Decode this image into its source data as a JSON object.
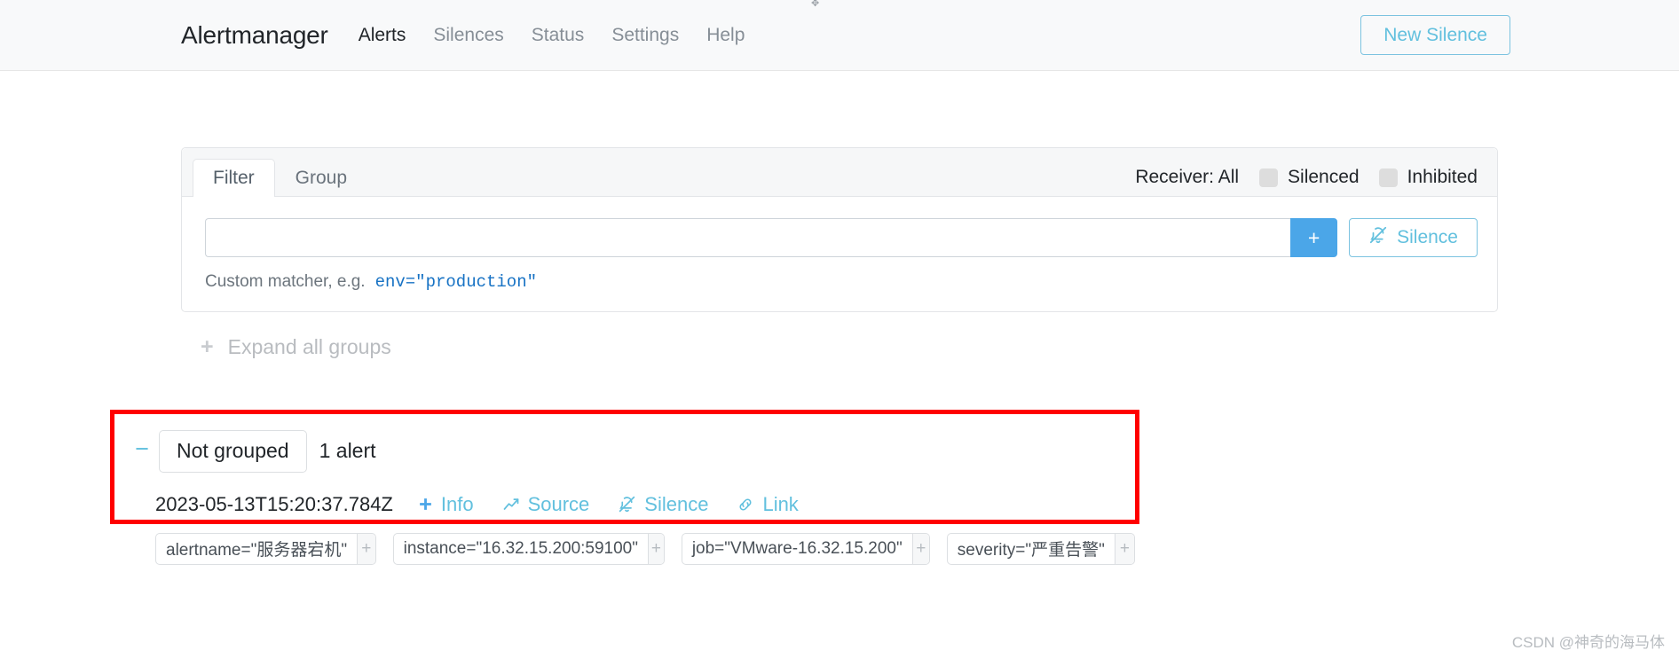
{
  "navbar": {
    "brand": "Alertmanager",
    "links": [
      {
        "label": "Alerts",
        "active": true
      },
      {
        "label": "Silences",
        "active": false
      },
      {
        "label": "Status",
        "active": false
      },
      {
        "label": "Settings",
        "active": false
      },
      {
        "label": "Help",
        "active": false
      }
    ],
    "new_silence_label": "New Silence"
  },
  "filter_card": {
    "tabs": [
      {
        "label": "Filter",
        "active": true
      },
      {
        "label": "Group",
        "active": false
      }
    ],
    "receiver_label": "Receiver: All",
    "checkboxes": [
      {
        "label": "Silenced",
        "checked": false
      },
      {
        "label": "Inhibited",
        "checked": false
      }
    ],
    "matcher_input_value": "",
    "matcher_input_placeholder": "",
    "add_button_label": "+",
    "silence_button_label": "Silence",
    "matcher_help_prefix": "Custom matcher, e.g.",
    "matcher_help_code": "env=\"production\""
  },
  "expand_all": {
    "icon_label": "+",
    "label": "Expand all groups"
  },
  "group": {
    "collapse_icon_label": "−",
    "name": "Not grouped",
    "alert_count": "1 alert",
    "alerts": [
      {
        "timestamp": "2023-05-13T15:20:37.784Z",
        "actions": [
          {
            "label": "Info",
            "icon": "plus-icon"
          },
          {
            "label": "Source",
            "icon": "chart-line-icon"
          },
          {
            "label": "Silence",
            "icon": "bell-slash-icon"
          },
          {
            "label": "Link",
            "icon": "link-icon"
          }
        ],
        "labels": [
          {
            "text": "alertname=\"服务器宕机\"",
            "add_label": "+"
          },
          {
            "text": "instance=\"16.32.15.200:59100\"",
            "add_label": "+"
          },
          {
            "text": "job=\"VMware-16.32.15.200\"",
            "add_label": "+"
          },
          {
            "text": "severity=\"严重告警\"",
            "add_label": "+"
          }
        ]
      }
    ]
  },
  "watermark": "CSDN @神奇的海马体",
  "colors": {
    "accent_blue": "#62c0de",
    "primary_blue": "#4ba6e8",
    "code_blue": "#1772c4",
    "highlight_red": "#ff0000",
    "muted_gray": "#868e96"
  }
}
